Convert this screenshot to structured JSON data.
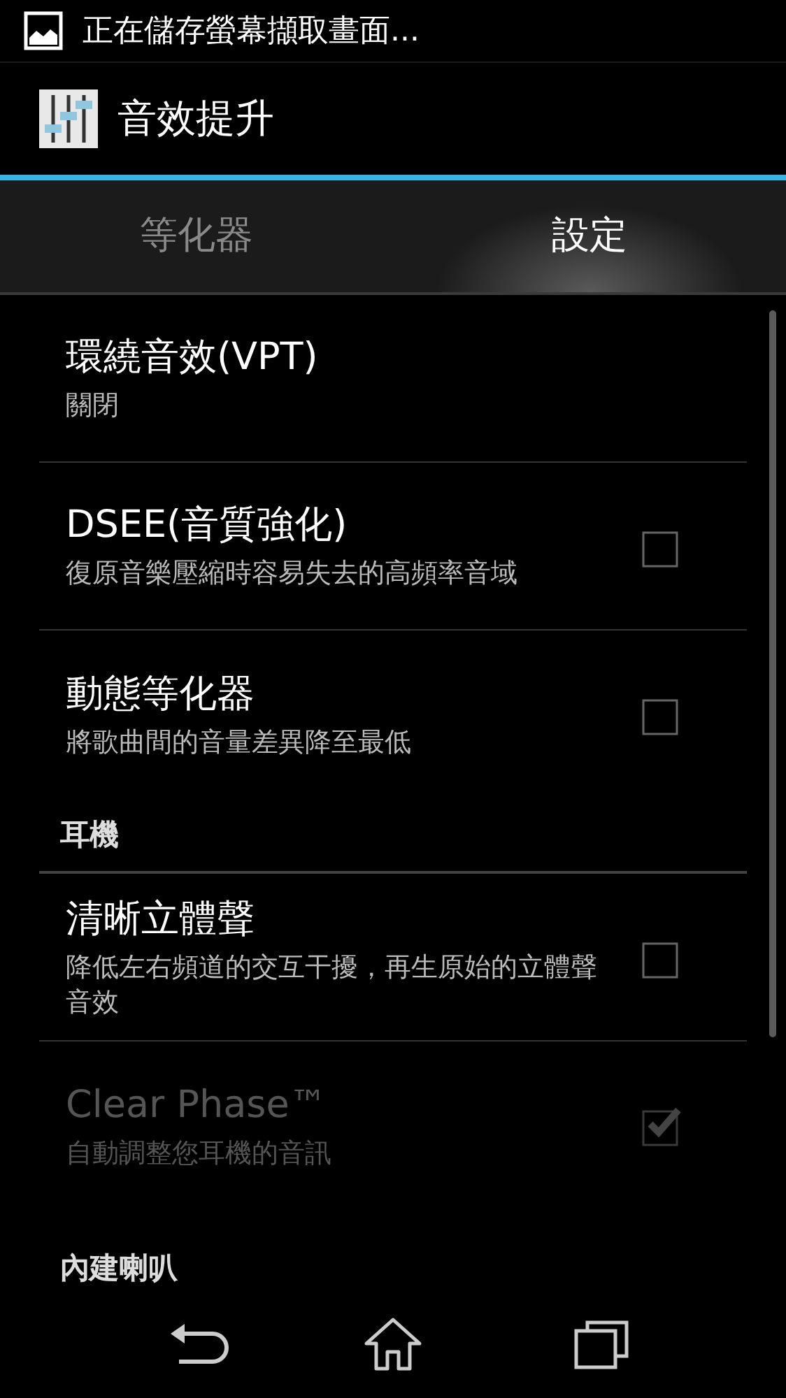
{
  "status_bar": {
    "notification": "正在儲存螢幕擷取畫面..."
  },
  "action_bar": {
    "title": "音效提升"
  },
  "tabs": [
    {
      "label": "等化器",
      "selected": false
    },
    {
      "label": "設定",
      "selected": true
    }
  ],
  "settings": [
    {
      "kind": "option",
      "title": "環繞音效(VPT)",
      "summary": "關閉",
      "disabled": false
    },
    {
      "kind": "toggle",
      "title": "DSEE(音質強化)",
      "summary": "復原音樂壓縮時容易失去的高頻率音域",
      "checked": false,
      "disabled": false
    },
    {
      "kind": "toggle",
      "title": "動態等化器",
      "summary": "將歌曲間的音量差異降至最低",
      "checked": false,
      "disabled": false
    },
    {
      "kind": "header",
      "title": "耳機"
    },
    {
      "kind": "toggle",
      "title": "清晰立體聲",
      "summary": "降低左右頻道的交互干擾，再生原始的立體聲音效",
      "checked": false,
      "disabled": false
    },
    {
      "kind": "toggle",
      "title": "Clear Phase™",
      "summary": "自動調整您耳機的音訊",
      "checked": true,
      "disabled": true
    },
    {
      "kind": "header",
      "title": "內建喇叭"
    }
  ]
}
